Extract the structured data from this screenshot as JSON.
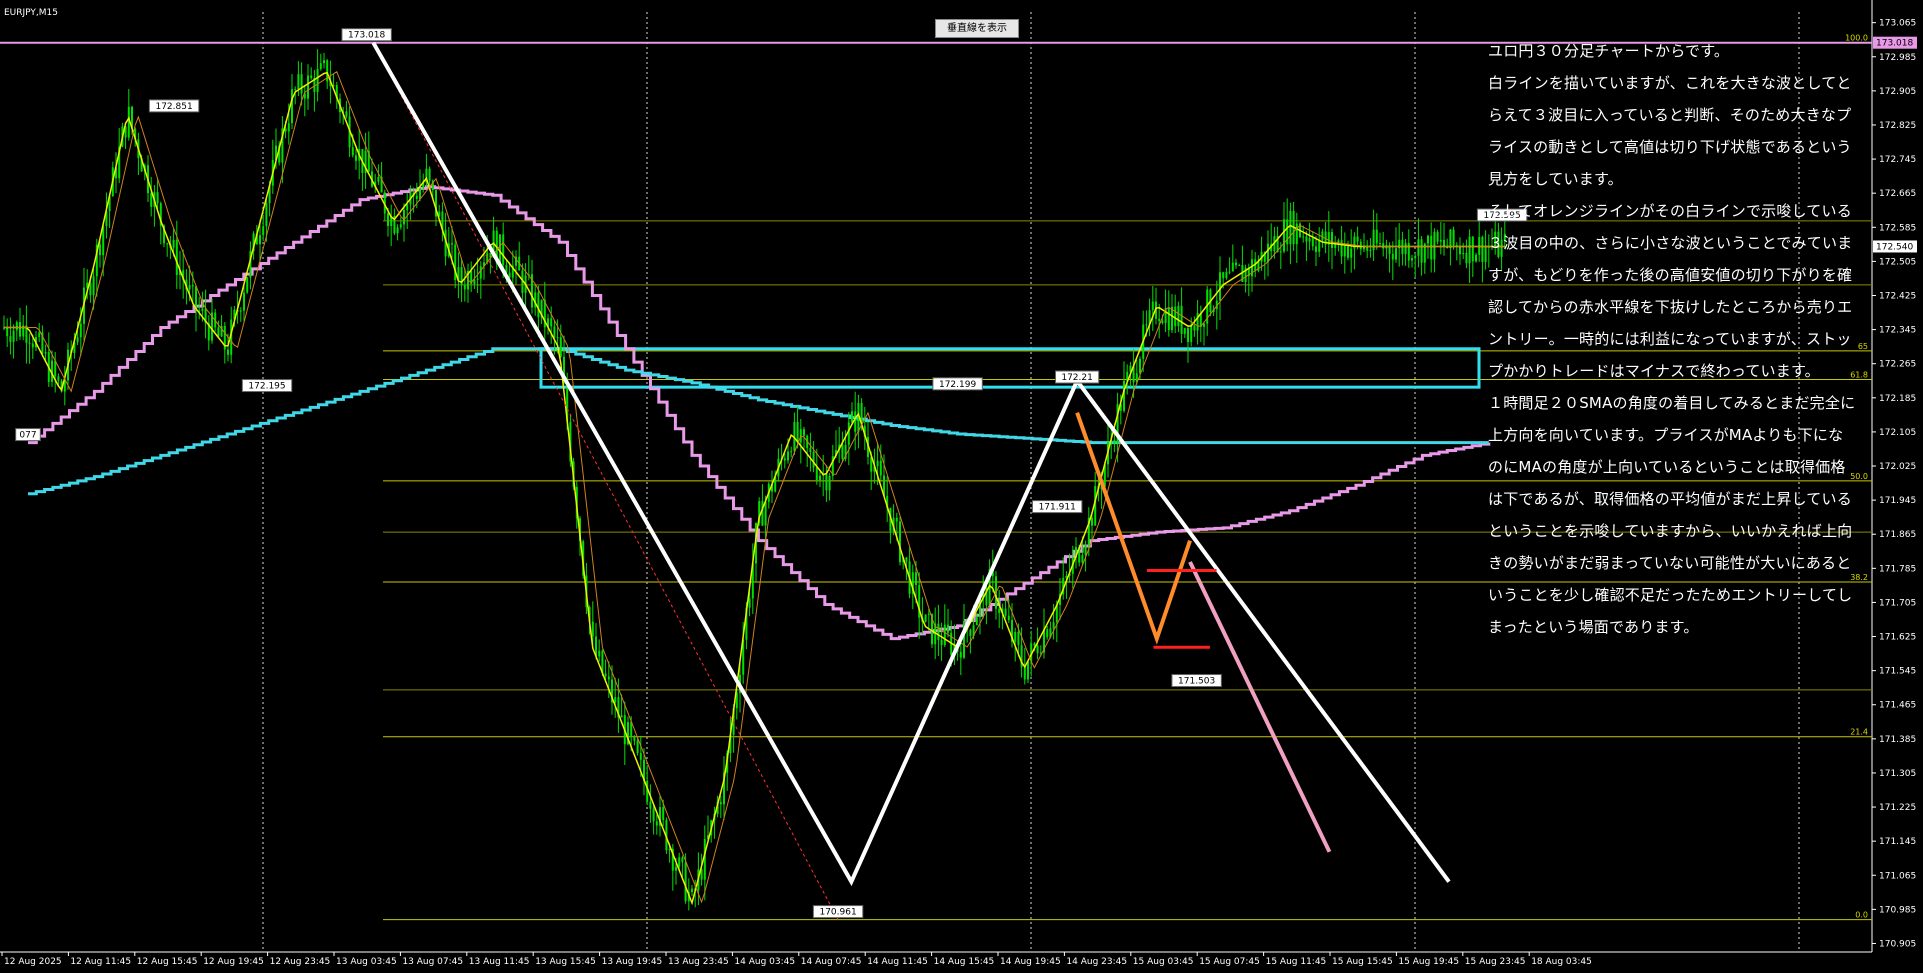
{
  "window": {
    "symbol_label": "EURJPY,M15",
    "vline_button_label": "垂直線を表示"
  },
  "colors": {
    "background": "#000000",
    "candles": "#00e000",
    "white_wave": "#ffffff",
    "orange_wave": "#ff8c2a",
    "pink_trend": "#f0a0c0",
    "magenta_ma": "#e89ae8",
    "cyan_ma": "#40d8e8",
    "fib": "#c8c800",
    "cyan_box": "#30e0f0",
    "red_lines": "#ff2020"
  },
  "chart_data": {
    "type": "candlestick",
    "symbol": "EURJPY",
    "timeframe": "M15",
    "x_ticks": [
      "12 Aug 2025",
      "12 Aug 11:45",
      "12 Aug 15:45",
      "12 Aug 19:45",
      "12 Aug 23:45",
      "13 Aug 03:45",
      "13 Aug 07:45",
      "13 Aug 11:45",
      "13 Aug 15:45",
      "13 Aug 19:45",
      "13 Aug 23:45",
      "14 Aug 03:45",
      "14 Aug 07:45",
      "14 Aug 11:45",
      "14 Aug 15:45",
      "14 Aug 19:45",
      "14 Aug 23:45",
      "15 Aug 03:45",
      "15 Aug 07:45",
      "15 Aug 11:45",
      "15 Aug 15:45",
      "15 Aug 19:45",
      "15 Aug 23:45",
      "18 Aug 03:45"
    ],
    "y_ticks": [
      "173.065",
      "172.985",
      "172.905",
      "172.825",
      "172.745",
      "172.665",
      "172.585",
      "172.505",
      "172.425",
      "172.345",
      "172.265",
      "172.185",
      "172.105",
      "172.025",
      "171.945",
      "171.865",
      "171.785",
      "171.705",
      "171.625",
      "171.545",
      "171.465",
      "171.385",
      "171.305",
      "171.225",
      "171.145",
      "171.065",
      "170.985",
      "170.905"
    ],
    "ylim": [
      170.885,
      173.09
    ],
    "current_price": "172.540",
    "top_line_price": "173.018",
    "price_callouts": [
      {
        "label": "173.018",
        "x_index": 5.1,
        "price": 173.018
      },
      {
        "label": "172.851",
        "x_index": 2.2,
        "price": 172.851
      },
      {
        "label": "172.195",
        "x_index": 3.6,
        "price": 172.195
      },
      {
        "label": "172.199",
        "x_index": 14.0,
        "price": 172.199
      },
      {
        "label": "172.21",
        "x_index": 15.8,
        "price": 172.215
      },
      {
        "label": "171.911",
        "x_index": 15.5,
        "price": 171.911
      },
      {
        "label": "171.503",
        "x_index": 17.6,
        "price": 171.503
      },
      {
        "label": "170.961",
        "x_index": 12.2,
        "price": 170.961
      },
      {
        "label": "172.595",
        "x_index": 22.2,
        "price": 172.595
      },
      {
        "label": "077",
        "x_index": 0.0,
        "price": 172.08
      }
    ],
    "fib_levels": [
      {
        "label": "100.0",
        "price": 173.018
      },
      {
        "label": "65",
        "price": 172.295
      },
      {
        "label": "61.8",
        "price": 172.228
      },
      {
        "label": "50.0",
        "price": 171.99
      },
      {
        "label": "38.2",
        "price": 171.753
      },
      {
        "label": "21.4",
        "price": 171.39
      },
      {
        "label": "0.0",
        "price": 170.961
      }
    ],
    "series": [
      {
        "name": "close",
        "x": [
          0,
          0.5,
          1,
          1.5,
          2,
          2.5,
          3,
          3.5,
          4,
          4.5,
          5,
          5.5,
          6,
          6.5,
          7,
          7.5,
          8,
          8.5,
          9,
          9.5,
          10,
          10.5,
          11,
          11.5,
          12,
          12.5,
          13,
          13.5,
          14,
          14.5,
          15,
          15.5,
          16,
          16.5,
          17,
          17.5,
          18,
          18.5,
          19,
          19.5,
          20,
          20.5,
          21,
          21.5,
          22,
          22.5,
          23
        ],
        "y": [
          172.35,
          172.2,
          172.5,
          172.85,
          172.6,
          172.4,
          172.3,
          172.6,
          172.9,
          172.95,
          172.75,
          172.6,
          172.7,
          172.45,
          172.55,
          172.45,
          172.3,
          171.6,
          171.4,
          171.2,
          171.0,
          171.3,
          171.9,
          172.1,
          172.0,
          172.15,
          171.9,
          171.65,
          171.6,
          171.75,
          171.55,
          171.7,
          171.9,
          172.2,
          172.4,
          172.35,
          172.45,
          172.5,
          172.59,
          172.55,
          172.54,
          172.54,
          172.54,
          172.54,
          172.54,
          172.54,
          172.54
        ]
      },
      {
        "name": "MA_magenta",
        "x": [
          0,
          1,
          2,
          3,
          4,
          5,
          6,
          7,
          8,
          9,
          10,
          11,
          12,
          13,
          14,
          15,
          16,
          17,
          18,
          19,
          20,
          21,
          22
        ],
        "y": [
          172.08,
          172.2,
          172.35,
          172.45,
          172.55,
          172.65,
          172.68,
          172.66,
          172.55,
          172.3,
          172.05,
          171.85,
          171.7,
          171.62,
          171.65,
          171.75,
          171.85,
          171.87,
          171.88,
          171.92,
          171.98,
          172.05,
          172.08
        ]
      },
      {
        "name": "MA_cyan",
        "x": [
          0,
          1,
          2,
          3,
          4,
          5,
          6,
          7,
          8,
          9,
          10,
          11,
          12,
          13,
          14,
          15,
          16,
          17,
          18,
          19,
          20,
          21,
          22
        ],
        "y": [
          171.96,
          172.0,
          172.05,
          172.1,
          172.15,
          172.2,
          172.25,
          172.3,
          172.3,
          172.25,
          172.22,
          172.18,
          172.15,
          172.12,
          172.1,
          172.09,
          172.08,
          172.08,
          172.08,
          172.08,
          172.08,
          172.08,
          172.08
        ]
      }
    ],
    "white_wave": [
      [
        5.2,
        173.018
      ],
      [
        12.4,
        171.05
      ],
      [
        15.8,
        172.225
      ],
      [
        21.4,
        171.05
      ]
    ],
    "orange_wave": [
      [
        15.8,
        172.15
      ],
      [
        17.0,
        171.62
      ],
      [
        17.5,
        171.85
      ]
    ],
    "pink_trend": [
      [
        17.5,
        171.8
      ],
      [
        19.6,
        171.12
      ]
    ]
  },
  "commentary": {
    "lines": [
      "ユロ円３０分足チャートからです。",
      "白ラインを描いていますが、これを大きな波としてと",
      "らえて３波目に入っていると判断、そのため大きなプ",
      "ライスの動きとして高値は切り下げ状態であるという",
      "見方をしています。",
      "そしてオレンジラインがその白ラインで示唆している",
      "３波目の中の、さらに小さな波ということでみていま",
      "すが、もどりを作った後の高値安値の切り下がりを確",
      "認してからの赤水平線を下抜けしたところから売りエ",
      "ントリー。一時的には利益になっていますが、ストッ",
      "プかかりトレードはマイナスで終わっています。",
      "１時間足２０SMAの角度の着目してみるとまだ完全に",
      "上方向を向いています。プライスがMAよりも下にな",
      "のにMAの角度が上向いているということは取得価格",
      "は下であるが、取得価格の平均値がまだ上昇している",
      "ということを示唆していますから、いいかえれば上向",
      "きの勢いがまだ弱まっていない可能性が大いにあると",
      "いうことを少し確認不足だったためエントリーしてし",
      "まったという場面であります。"
    ]
  }
}
